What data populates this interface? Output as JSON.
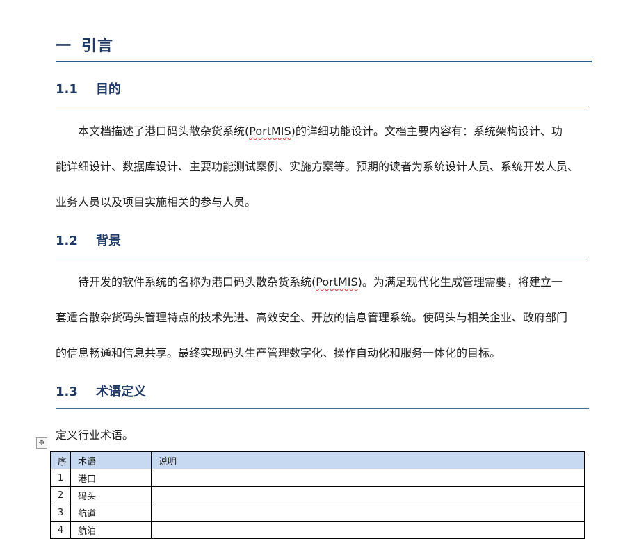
{
  "heading1": {
    "number": "一",
    "title": "引言"
  },
  "sections": [
    {
      "number": "1.1",
      "title": "目的",
      "lines": [
        [
          "本文档描述了港口码头散杂货系统(",
          "PortMIS",
          ")的详细功能设计。文档主要内容有：系统架构设计、功"
        ],
        [
          "能详细设计、数据库设计、主要功能测试案例、实施方案等。预期的读者为系统设计人员、系统开发人员、"
        ],
        [
          "业务人员以及项目实施相关的参与人员。"
        ]
      ]
    },
    {
      "number": "1.2",
      "title": "背景",
      "lines": [
        [
          "待开发的软件系统的名称为港口码头散杂货系统(",
          "PortMIS",
          ")。为满足现代化生成管理需要，将建立一"
        ],
        [
          "套适合散杂货码头管理特点的技术先进、高效安全、开放的信息管理系统。使码头与相关企业、政府部门"
        ],
        [
          "的信息畅通和信息共享。最终实现码头生产管理数字化、操作自动化和服务一体化的目标。"
        ]
      ]
    },
    {
      "number": "1.3",
      "title": "术语定义",
      "intro": "定义行业术语。"
    }
  ],
  "table": {
    "headers": [
      "序",
      "术语",
      "说明"
    ],
    "rows": [
      [
        "1",
        "港口",
        ""
      ],
      [
        "2",
        "码头",
        ""
      ],
      [
        "3",
        "航道",
        ""
      ],
      [
        "4",
        "航泊",
        ""
      ]
    ]
  },
  "icons": {
    "table_move": "move-icon"
  },
  "colors": {
    "heading": "#1f3864",
    "rule": "#2e5a8a",
    "table_header_bg": "#c6d9f1",
    "spellcheck": "#d23b3b"
  }
}
